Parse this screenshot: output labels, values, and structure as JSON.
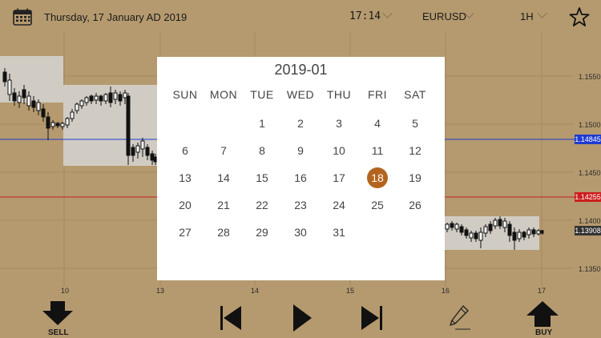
{
  "header": {
    "date": "Thursday, 17 January AD 2019",
    "time": "17:14",
    "symbol": "EURUSD",
    "timeframe": "1H",
    "calendar_icon": "calendar-icon",
    "favorite_icon": "star-icon"
  },
  "chart": {
    "price_labels": [
      "1.1550",
      "1.1500",
      "1.1450",
      "1.1400",
      "1.1350"
    ],
    "price_tags": [
      {
        "value": "1.14845",
        "color": "#1f3bd1"
      },
      {
        "value": "1.14255",
        "color": "#cc1f1f"
      },
      {
        "value": "1.13908",
        "color": "#333333"
      }
    ],
    "date_labels": [
      "10",
      "13",
      "14",
      "15",
      "16",
      "17"
    ]
  },
  "calendar": {
    "title": "2019-01",
    "weekdays": [
      "SUN",
      "MON",
      "TUE",
      "WED",
      "THU",
      "FRI",
      "SAT"
    ],
    "weeks": [
      [
        "",
        "",
        "1",
        "2",
        "3",
        "4",
        "5"
      ],
      [
        "6",
        "7",
        "8",
        "9",
        "10",
        "11",
        "12"
      ],
      [
        "13",
        "14",
        "15",
        "16",
        "17",
        "18",
        "19"
      ],
      [
        "20",
        "21",
        "22",
        "23",
        "24",
        "25",
        "26"
      ],
      [
        "27",
        "28",
        "29",
        "30",
        "31",
        "",
        ""
      ]
    ],
    "selected": "18",
    "selected_color": "#b3641e"
  },
  "toolbar": {
    "sell_label": "SELL",
    "buy_label": "BUY",
    "skip_back_icon": "skip-back-icon",
    "play_icon": "play-icon",
    "skip_forward_icon": "skip-forward-icon",
    "pencil_icon": "pencil-icon"
  }
}
